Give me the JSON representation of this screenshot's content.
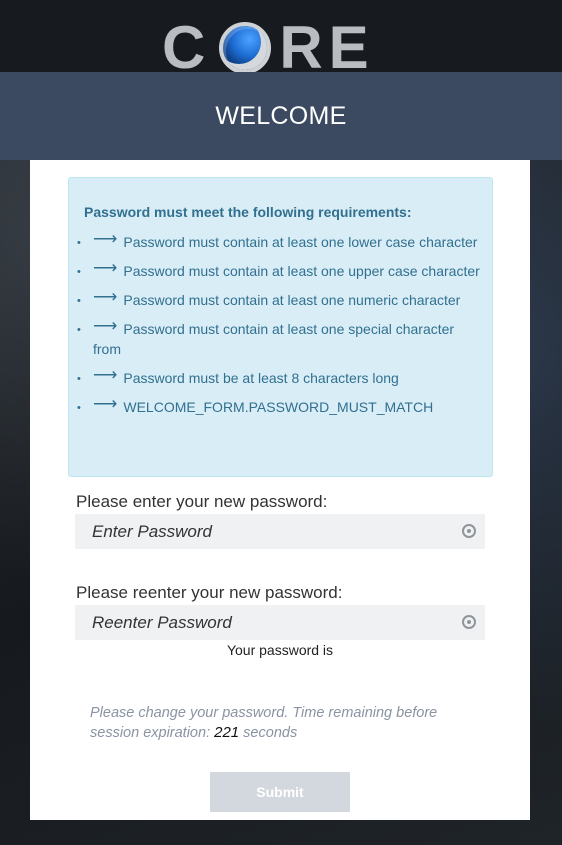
{
  "brand": {
    "logo_left": "C",
    "logo_right": "RE"
  },
  "banner": {
    "title": "WELCOME"
  },
  "requirements": {
    "title": "Password must meet the following requirements:",
    "bullet": "•",
    "arrow": "⟶",
    "items": [
      "Password must contain at least one lower case character",
      "Password must contain at least one upper case character",
      "Password must contain at least one numeric character",
      "Password must contain at least one special character from",
      "Password must be at least 8 characters long",
      "WELCOME_FORM.PASSWORD_MUST_MATCH"
    ]
  },
  "form": {
    "new_password_label": "Please enter your new password:",
    "new_password_placeholder": "Enter Password",
    "reenter_label": "Please reenter your new password:",
    "reenter_placeholder": "Reenter Password",
    "strength_text": "Your password is",
    "submit_label": "Submit"
  },
  "session": {
    "message_before": "Please change your password. Time remaining before session expiration: ",
    "seconds_remaining": "221",
    "message_after": " seconds"
  },
  "colors": {
    "banner": "#3c4a61",
    "info_bg": "#d9edf7",
    "info_text": "#31708f",
    "submit_disabled": "#d3d8de"
  }
}
